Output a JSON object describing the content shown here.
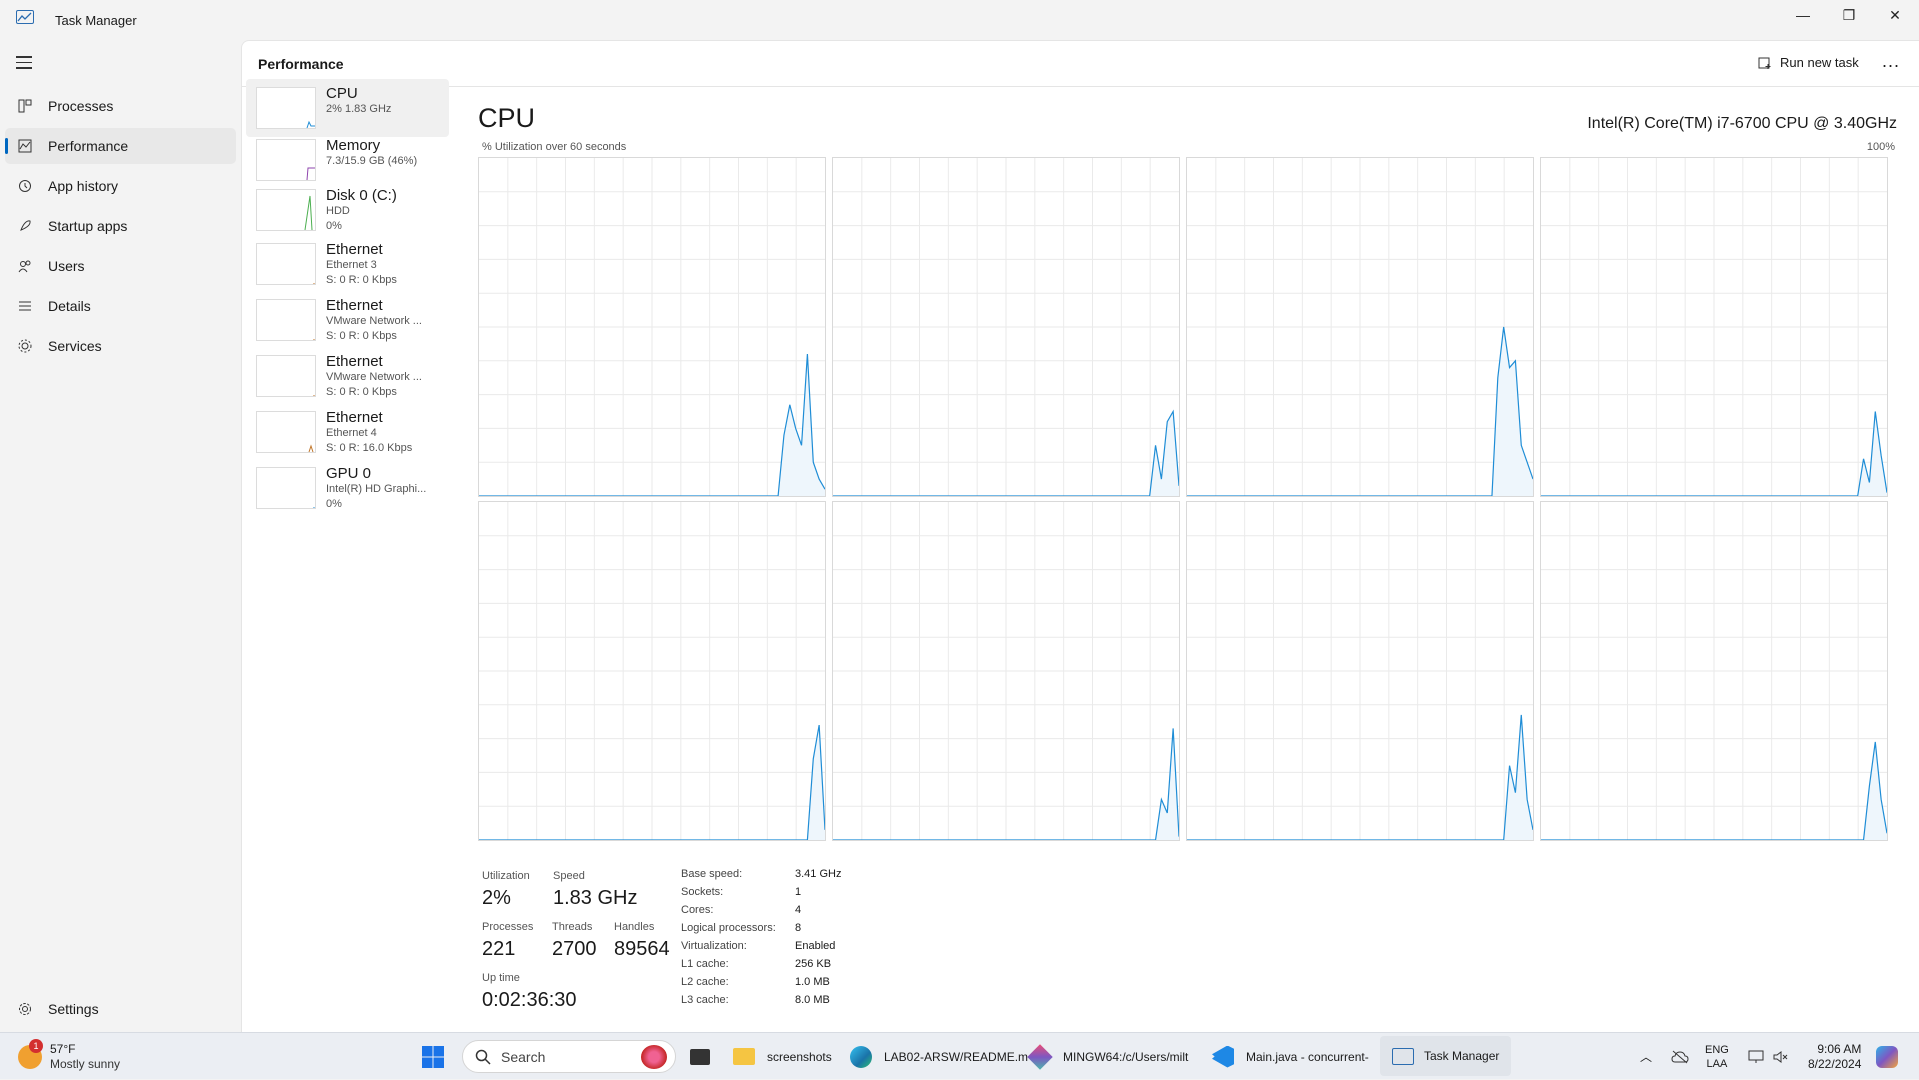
{
  "app": {
    "title": "Task Manager"
  },
  "window_controls": {
    "minimize": "—",
    "maximize": "❐",
    "close": "✕"
  },
  "sidebar": {
    "items": [
      {
        "label": "Processes",
        "icon": "processes-icon"
      },
      {
        "label": "Performance",
        "icon": "performance-icon",
        "active": true
      },
      {
        "label": "App history",
        "icon": "history-icon"
      },
      {
        "label": "Startup apps",
        "icon": "startup-icon"
      },
      {
        "label": "Users",
        "icon": "users-icon"
      },
      {
        "label": "Details",
        "icon": "details-icon"
      },
      {
        "label": "Services",
        "icon": "services-icon"
      }
    ],
    "settings": {
      "label": "Settings",
      "icon": "gear-icon"
    }
  },
  "header": {
    "title": "Performance",
    "run_new_task": "Run new task",
    "more": "..."
  },
  "devices": [
    {
      "name": "CPU",
      "lines": [
        "2% 1.83 GHz"
      ],
      "color": "#1f8dd6"
    },
    {
      "name": "Memory",
      "lines": [
        "7.3/15.9 GB (46%)"
      ],
      "color": "#8e44ad"
    },
    {
      "name": "Disk 0 (C:)",
      "lines": [
        "HDD",
        "0%"
      ],
      "color": "#4caf50"
    },
    {
      "name": "Ethernet",
      "lines": [
        "Ethernet 3",
        "S: 0 R: 0 Kbps"
      ],
      "color": "#c0762a"
    },
    {
      "name": "Ethernet",
      "lines": [
        "VMware Network ...",
        "S: 0 R: 0 Kbps"
      ],
      "color": "#c0762a"
    },
    {
      "name": "Ethernet",
      "lines": [
        "VMware Network ...",
        "S: 0 R: 0 Kbps"
      ],
      "color": "#c0762a"
    },
    {
      "name": "Ethernet",
      "lines": [
        "Ethernet 4",
        "S: 0 R: 16.0 Kbps"
      ],
      "color": "#c0762a"
    },
    {
      "name": "GPU 0",
      "lines": [
        "Intel(R) HD Graphi...",
        "0%"
      ],
      "color": "#1f8dd6"
    }
  ],
  "cpu": {
    "title": "CPU",
    "model": "Intel(R) Core(TM) i7-6700 CPU @ 3.40GHz",
    "utilization_label": "% Utilization over 60 seconds",
    "max_label": "100%",
    "line_color": "#1f8dd6",
    "stats": {
      "utilization_label": "Utilization",
      "utilization": "2%",
      "speed_label": "Speed",
      "speed": "1.83 GHz",
      "processes_label": "Processes",
      "processes": "221",
      "threads_label": "Threads",
      "threads": "2700",
      "handles_label": "Handles",
      "handles": "89564",
      "uptime_label": "Up time",
      "uptime": "0:02:36:30"
    },
    "specs": [
      {
        "key": "Base speed:",
        "value": "3.41 GHz"
      },
      {
        "key": "Sockets:",
        "value": "1"
      },
      {
        "key": "Cores:",
        "value": "4"
      },
      {
        "key": "Logical processors:",
        "value": "8"
      },
      {
        "key": "Virtualization:",
        "value": "Enabled"
      },
      {
        "key": "L1 cache:",
        "value": "256 KB"
      },
      {
        "key": "L2 cache:",
        "value": "1.0 MB"
      },
      {
        "key": "L3 cache:",
        "value": "8.0 MB"
      }
    ]
  },
  "chart_data": {
    "type": "line",
    "xlabel": "",
    "ylabel": "% Utilization over 60 seconds",
    "ylim": [
      0,
      100
    ],
    "series": [
      {
        "values": [
          0,
          0,
          0,
          0,
          0,
          0,
          0,
          0,
          0,
          0,
          0,
          0,
          0,
          0,
          0,
          0,
          0,
          0,
          0,
          0,
          0,
          0,
          0,
          0,
          0,
          0,
          0,
          0,
          0,
          0,
          0,
          0,
          0,
          0,
          0,
          0,
          0,
          0,
          0,
          0,
          0,
          0,
          0,
          0,
          0,
          0,
          0,
          0,
          0,
          0,
          0,
          0,
          18,
          27,
          20,
          15,
          42,
          10,
          5,
          2
        ]
      },
      {
        "values": [
          0,
          0,
          0,
          0,
          0,
          0,
          0,
          0,
          0,
          0,
          0,
          0,
          0,
          0,
          0,
          0,
          0,
          0,
          0,
          0,
          0,
          0,
          0,
          0,
          0,
          0,
          0,
          0,
          0,
          0,
          0,
          0,
          0,
          0,
          0,
          0,
          0,
          0,
          0,
          0,
          0,
          0,
          0,
          0,
          0,
          0,
          0,
          0,
          0,
          0,
          0,
          0,
          0,
          0,
          0,
          15,
          5,
          22,
          25,
          3
        ]
      },
      {
        "values": [
          0,
          0,
          0,
          0,
          0,
          0,
          0,
          0,
          0,
          0,
          0,
          0,
          0,
          0,
          0,
          0,
          0,
          0,
          0,
          0,
          0,
          0,
          0,
          0,
          0,
          0,
          0,
          0,
          0,
          0,
          0,
          0,
          0,
          0,
          0,
          0,
          0,
          0,
          0,
          0,
          0,
          0,
          0,
          0,
          0,
          0,
          0,
          0,
          0,
          0,
          0,
          0,
          0,
          35,
          50,
          38,
          40,
          15,
          10,
          5
        ]
      },
      {
        "values": [
          0,
          0,
          0,
          0,
          0,
          0,
          0,
          0,
          0,
          0,
          0,
          0,
          0,
          0,
          0,
          0,
          0,
          0,
          0,
          0,
          0,
          0,
          0,
          0,
          0,
          0,
          0,
          0,
          0,
          0,
          0,
          0,
          0,
          0,
          0,
          0,
          0,
          0,
          0,
          0,
          0,
          0,
          0,
          0,
          0,
          0,
          0,
          0,
          0,
          0,
          0,
          0,
          0,
          0,
          0,
          11,
          4,
          25,
          12,
          1
        ]
      },
      {
        "values": [
          0,
          0,
          0,
          0,
          0,
          0,
          0,
          0,
          0,
          0,
          0,
          0,
          0,
          0,
          0,
          0,
          0,
          0,
          0,
          0,
          0,
          0,
          0,
          0,
          0,
          0,
          0,
          0,
          0,
          0,
          0,
          0,
          0,
          0,
          0,
          0,
          0,
          0,
          0,
          0,
          0,
          0,
          0,
          0,
          0,
          0,
          0,
          0,
          0,
          0,
          0,
          0,
          0,
          0,
          0,
          0,
          0,
          24,
          34,
          3
        ]
      },
      {
        "values": [
          0,
          0,
          0,
          0,
          0,
          0,
          0,
          0,
          0,
          0,
          0,
          0,
          0,
          0,
          0,
          0,
          0,
          0,
          0,
          0,
          0,
          0,
          0,
          0,
          0,
          0,
          0,
          0,
          0,
          0,
          0,
          0,
          0,
          0,
          0,
          0,
          0,
          0,
          0,
          0,
          0,
          0,
          0,
          0,
          0,
          0,
          0,
          0,
          0,
          0,
          0,
          0,
          0,
          0,
          0,
          0,
          12,
          8,
          33,
          1
        ]
      },
      {
        "values": [
          0,
          0,
          0,
          0,
          0,
          0,
          0,
          0,
          0,
          0,
          0,
          0,
          0,
          0,
          0,
          0,
          0,
          0,
          0,
          0,
          0,
          0,
          0,
          0,
          0,
          0,
          0,
          0,
          0,
          0,
          0,
          0,
          0,
          0,
          0,
          0,
          0,
          0,
          0,
          0,
          0,
          0,
          0,
          0,
          0,
          0,
          0,
          0,
          0,
          0,
          0,
          0,
          0,
          0,
          0,
          22,
          14,
          37,
          12,
          3
        ]
      },
      {
        "values": [
          0,
          0,
          0,
          0,
          0,
          0,
          0,
          0,
          0,
          0,
          0,
          0,
          0,
          0,
          0,
          0,
          0,
          0,
          0,
          0,
          0,
          0,
          0,
          0,
          0,
          0,
          0,
          0,
          0,
          0,
          0,
          0,
          0,
          0,
          0,
          0,
          0,
          0,
          0,
          0,
          0,
          0,
          0,
          0,
          0,
          0,
          0,
          0,
          0,
          0,
          0,
          0,
          0,
          0,
          0,
          0,
          16,
          29,
          12,
          2
        ]
      }
    ]
  },
  "taskbar": {
    "weather": {
      "temp": "57°F",
      "desc": "Mostly sunny",
      "badge": "1"
    },
    "search_placeholder": "Search",
    "apps": [
      {
        "label": "screenshots",
        "icon": "folder-icon"
      },
      {
        "label": "LAB02-ARSW/README.m",
        "icon": "edge-icon"
      },
      {
        "label": "MINGW64:/c/Users/milt",
        "icon": "git-bash-icon"
      },
      {
        "label": "Main.java - concurrent-",
        "icon": "vscode-icon"
      },
      {
        "label": "Task Manager",
        "icon": "task-manager-icon"
      }
    ],
    "lang": {
      "line1": "ENG",
      "line2": "LAA"
    },
    "clock": {
      "time": "9:06 AM",
      "date": "8/22/2024"
    }
  }
}
